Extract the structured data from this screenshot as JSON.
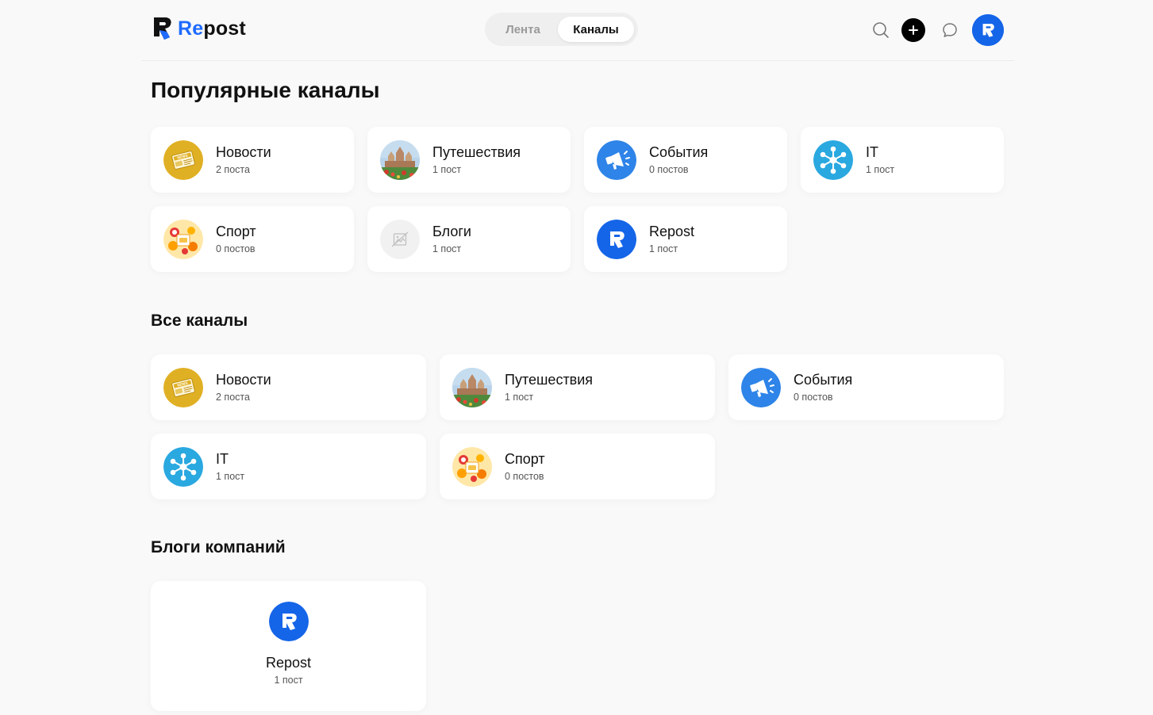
{
  "app": {
    "logo_re": "Re",
    "logo_post": "post"
  },
  "tabs": [
    {
      "label": "Лента"
    },
    {
      "label": "Каналы"
    }
  ],
  "header_icons": [
    "search-icon",
    "plus-icon",
    "chat-icon",
    "profile-avatar"
  ],
  "sections": {
    "popular": {
      "title": "Популярные каналы",
      "items": [
        {
          "name": "Новости",
          "count": "2 поста",
          "icon": "news-icon"
        },
        {
          "name": "Путешествия",
          "count": "1 пост",
          "icon": "travel-photo"
        },
        {
          "name": "События",
          "count": "0 постов",
          "icon": "megaphone-icon"
        },
        {
          "name": "IT",
          "count": "1 пост",
          "icon": "network-icon"
        },
        {
          "name": "Спорт",
          "count": "0 постов",
          "icon": "sport-icon"
        },
        {
          "name": "Блоги",
          "count": "1 пост",
          "icon": "image-placeholder-icon"
        },
        {
          "name": "Repost",
          "count": "1 пост",
          "icon": "repost-logo-icon"
        }
      ]
    },
    "all": {
      "title": "Все каналы",
      "items": [
        {
          "name": "Новости",
          "count": "2 поста",
          "icon": "news-icon"
        },
        {
          "name": "Путешествия",
          "count": "1 пост",
          "icon": "travel-photo"
        },
        {
          "name": "События",
          "count": "0 постов",
          "icon": "megaphone-icon"
        },
        {
          "name": "IT",
          "count": "1 пост",
          "icon": "network-icon"
        },
        {
          "name": "Спорт",
          "count": "0 постов",
          "icon": "sport-icon"
        }
      ]
    },
    "company_blogs": {
      "title": "Блоги компаний",
      "items": [
        {
          "name": "Repost",
          "count": "1 пост",
          "icon": "repost-logo-icon"
        }
      ]
    }
  },
  "colors": {
    "brand_blue": "#1f6bff",
    "page_bg": "#f9f9f9",
    "news_gold": "#e0b024",
    "it_cyan": "#2aa8e0"
  }
}
